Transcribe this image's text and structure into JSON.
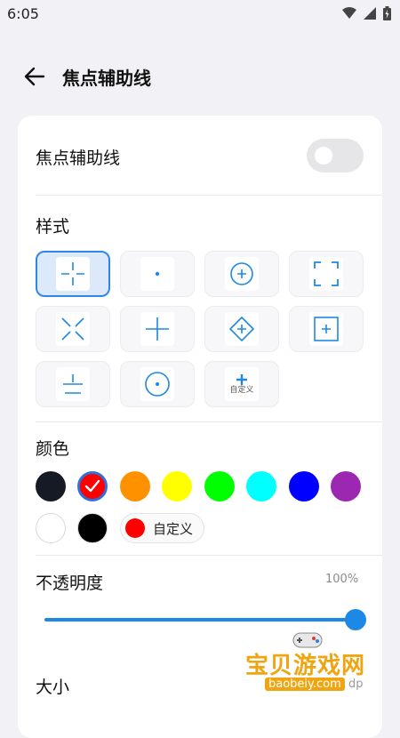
{
  "status_bar": {
    "time": "6:05",
    "icons": [
      "wifi-icon",
      "signal-icon",
      "battery-icon"
    ]
  },
  "header": {
    "title": "焦点辅助线",
    "back_icon": "arrow-left-icon"
  },
  "toggle_row": {
    "label": "焦点辅助线",
    "enabled": false
  },
  "style_section": {
    "title": "样式",
    "options": [
      {
        "icon": "crosshair-gap-icon",
        "selected": true
      },
      {
        "icon": "center-dot-icon",
        "selected": false
      },
      {
        "icon": "circle-plus-icon",
        "selected": false
      },
      {
        "icon": "corner-brackets-icon",
        "selected": false
      },
      {
        "icon": "x-cross-icon",
        "selected": false
      },
      {
        "icon": "plus-cross-icon",
        "selected": false
      },
      {
        "icon": "diamond-plus-icon",
        "selected": false
      },
      {
        "icon": "square-plus-icon",
        "selected": false
      },
      {
        "icon": "horizontal-lines-icon",
        "selected": false
      },
      {
        "icon": "circle-dot-icon",
        "selected": false
      },
      {
        "icon": "custom-plus-icon",
        "label": "自定义",
        "selected": false
      }
    ]
  },
  "color_section": {
    "title": "颜色",
    "colors": [
      {
        "hex": "#161a25",
        "selected": false
      },
      {
        "hex": "#ff0000",
        "selected": true
      },
      {
        "hex": "#ff9100",
        "selected": false
      },
      {
        "hex": "#ffff00",
        "selected": false
      },
      {
        "hex": "#00ff00",
        "selected": false
      },
      {
        "hex": "#00ffff",
        "selected": false
      },
      {
        "hex": "#0000ff",
        "selected": false
      },
      {
        "hex": "#9c27b0",
        "selected": false
      },
      {
        "hex": "#ffffff",
        "selected": false
      },
      {
        "hex": "#000000",
        "selected": false
      }
    ],
    "custom_button": {
      "label": "自定义",
      "dot_color": "#ff0000"
    }
  },
  "opacity_section": {
    "title": "不透明度",
    "value_text": "100%",
    "value": 1.0
  },
  "size_section": {
    "title": "大小"
  },
  "watermark": {
    "title": "宝贝游戏网",
    "url": "baobeiy.com",
    "suffix": "dp"
  },
  "accent_color": "#1e88e5"
}
